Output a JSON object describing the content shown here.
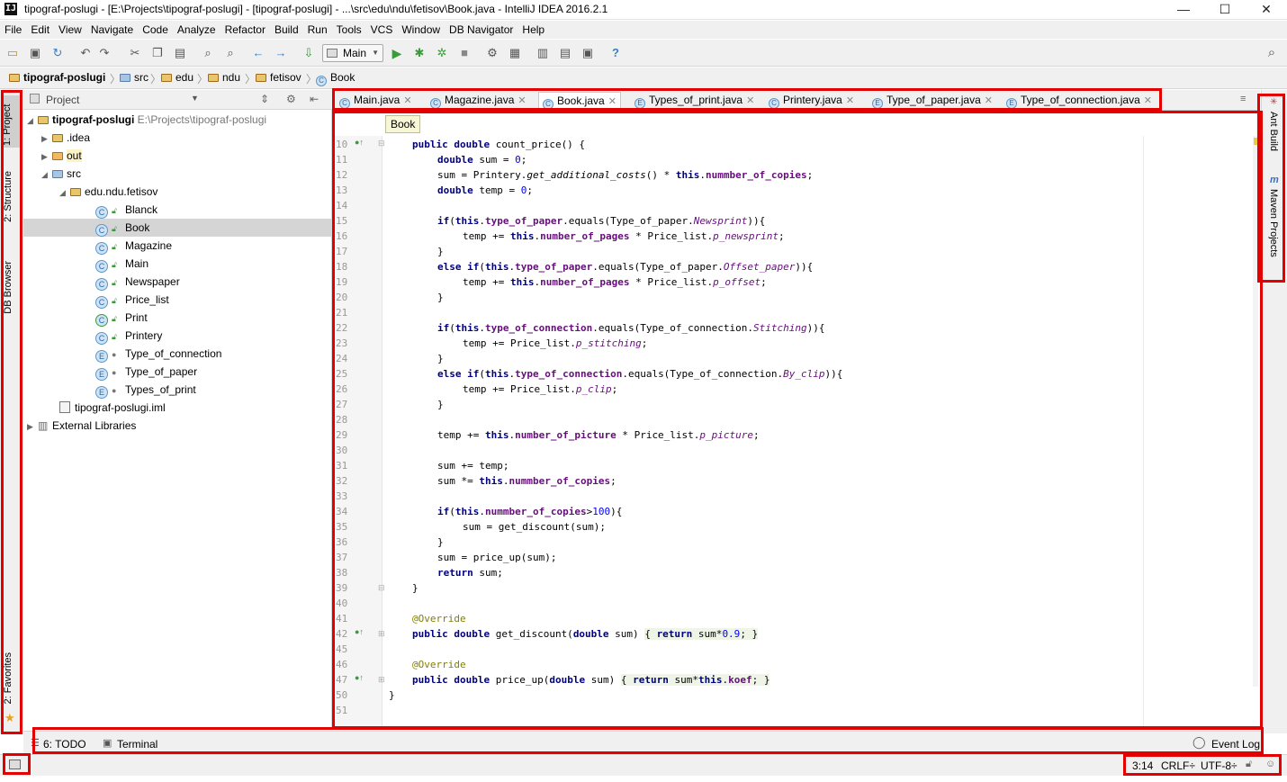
{
  "window": {
    "title": "tipograf-poslugi - [E:\\Projects\\tipograf-poslugi] - [tipograf-poslugi] - ...\\src\\edu\\ndu\\fetisov\\Book.java - IntelliJ IDEA 2016.2.1",
    "app_icon": "IJ",
    "minimize": "—",
    "maximize": "☐",
    "close": "✕"
  },
  "menu": [
    "File",
    "Edit",
    "View",
    "Navigate",
    "Code",
    "Analyze",
    "Refactor",
    "Build",
    "Run",
    "Tools",
    "VCS",
    "Window",
    "DB Navigator",
    "Help"
  ],
  "toolbar": {
    "run_config": "Main"
  },
  "breadcrumb": [
    "tipograf-poslugi",
    "src",
    "edu",
    "ndu",
    "fetisov",
    "Book"
  ],
  "left_strip": {
    "project": "1: Project",
    "structure": "2: Structure",
    "db_browser": "DB Browser",
    "favorites": "2: Favorites"
  },
  "right_strip": {
    "ant": "Ant Build",
    "maven": "Maven Projects"
  },
  "project_panel": {
    "title": "Project",
    "root": {
      "name": "tipograf-poslugi",
      "path": "E:\\Projects\\tipograf-poslugi"
    },
    "nodes": [
      ".idea",
      "out",
      "src",
      "edu.ndu.fetisov"
    ],
    "classes": [
      {
        "name": "Blanck",
        "kind": "C"
      },
      {
        "name": "Book",
        "kind": "C"
      },
      {
        "name": "Magazine",
        "kind": "C"
      },
      {
        "name": "Main",
        "kind": "C"
      },
      {
        "name": "Newspaper",
        "kind": "C"
      },
      {
        "name": "Price_list",
        "kind": "C"
      },
      {
        "name": "Print",
        "kind": "C"
      },
      {
        "name": "Printery",
        "kind": "C"
      },
      {
        "name": "Type_of_connection",
        "kind": "E"
      },
      {
        "name": "Type_of_paper",
        "kind": "E"
      },
      {
        "name": "Types_of_print",
        "kind": "E"
      }
    ],
    "iml": "tipograf-poslugi.iml",
    "external": "External Libraries"
  },
  "tabs": [
    {
      "label": "Main.java",
      "kind": "C"
    },
    {
      "label": "Magazine.java",
      "kind": "C"
    },
    {
      "label": "Book.java",
      "kind": "C"
    },
    {
      "label": "Types_of_print.java",
      "kind": "E"
    },
    {
      "label": "Printery.java",
      "kind": "C"
    },
    {
      "label": "Type_of_paper.java",
      "kind": "E"
    },
    {
      "label": "Type_of_connection.java",
      "kind": "E"
    }
  ],
  "editor": {
    "tooltip": "Book",
    "line_numbers": [
      "10",
      "11",
      "12",
      "13",
      "14",
      "15",
      "16",
      "17",
      "18",
      "19",
      "20",
      "21",
      "22",
      "23",
      "24",
      "25",
      "26",
      "27",
      "28",
      "29",
      "30",
      "31",
      "32",
      "33",
      "34",
      "35",
      "36",
      "37",
      "38",
      "39",
      "40",
      "41",
      "42",
      "45",
      "46",
      "47",
      "50",
      "51"
    ]
  },
  "bottom_tools": {
    "todo": "6: TODO",
    "terminal": "Terminal",
    "event_log": "Event Log"
  },
  "status": {
    "position": "3:14",
    "line_sep": "CRLF÷",
    "encoding": "UTF-8÷"
  }
}
